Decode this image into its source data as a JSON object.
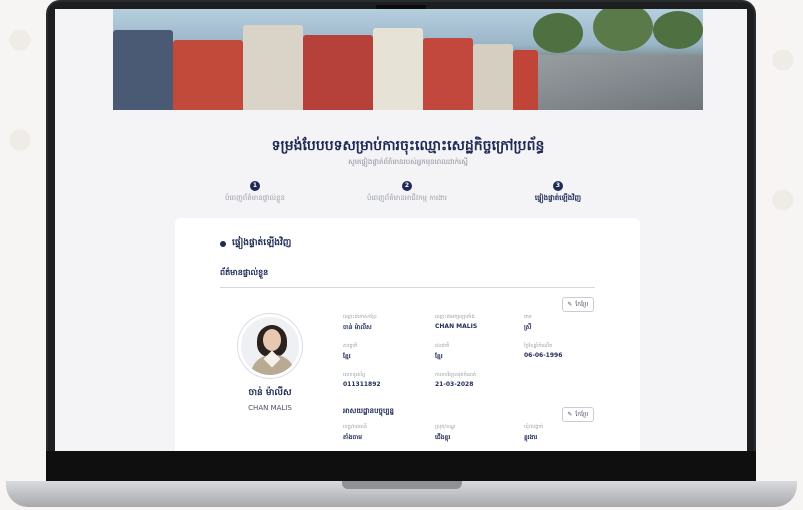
{
  "form": {
    "title": "ទម្រង់បែបបទសម្រាប់ការចុះឈ្មោះសេដ្ឋកិច្ចក្រៅប្រព័ន្ធ",
    "subtitle": "សូមផ្ទៀងផ្ទាត់ព័ត៌មានរបស់អ្នកមុនពេលដាក់ស្នើ"
  },
  "steps": [
    {
      "number": "1",
      "label": "បំពេញព័ត៌មានផ្ទាល់ខ្លួន"
    },
    {
      "number": "2",
      "label": "បំពេញព័ត៌មានអាជីវកម្ម ការងារ"
    },
    {
      "number": "3",
      "label": "ផ្ទៀងផ្ទាត់ឡើងវិញ"
    }
  ],
  "card": {
    "heading": "ផ្ទៀងផ្ទាត់ឡើងវិញ",
    "personal_section": "ព័ត៌មានផ្ទាល់ខ្លួន",
    "edit_label": "កែប្រែ",
    "business_section": "អាសយដ្ឋានបច្ចុប្បន្ន"
  },
  "profile": {
    "name_kh": "ចាន់ ម៉ាលីស",
    "name_en": "CHAN MALIS"
  },
  "fields": [
    {
      "key": "ឈ្មោះជាភាសាខ្មែរ",
      "value": "ចាន់ ម៉ាលីស"
    },
    {
      "key": "ឈ្មោះជាអក្សរឡាតាំង",
      "value": "CHAN MALIS"
    },
    {
      "key": "ភេទ",
      "value": "ស្រី"
    },
    {
      "key": "សញ្ជាតិ",
      "value": "ខ្មែរ"
    },
    {
      "key": "ជនជាតិ",
      "value": "ខ្មែរ"
    },
    {
      "key": "ថ្ងៃខែឆ្នាំកំណើត",
      "value": "06-06-1996"
    },
    {
      "key": "លេខទូរស័ព្ទ",
      "value": "011311892"
    },
    {
      "key": "កាលបរិច្ឆេទផុតកំណត់",
      "value": "21-03-2028"
    }
  ],
  "address_fields": [
    {
      "key": "ខេត្ត/រាជធានី",
      "value": "តាំងចាម"
    },
    {
      "key": "ស្រុក/ខណ្ឌ",
      "value": "ជើងខ្ពុរ"
    },
    {
      "key": "ឃុំ/សង្កាត់",
      "value": "ខ្ពុរងារ"
    }
  ],
  "colors": {
    "primary": "#1e2a55",
    "muted": "#9aa0aa"
  },
  "icons": {
    "edit": "pencil-icon"
  }
}
